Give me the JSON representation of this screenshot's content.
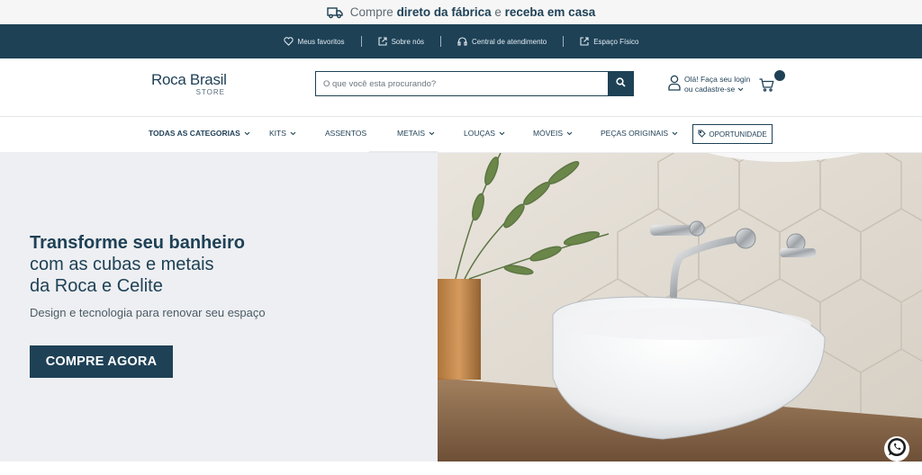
{
  "promo": {
    "prefix": "Compre",
    "bold1": "direto da fábrica",
    "mid": "e",
    "bold2": "receba em casa",
    "icon": "truck-icon"
  },
  "utility": {
    "items": [
      {
        "label": "Meus favoritos",
        "icon": "heart-icon"
      },
      {
        "label": "Sobre nós",
        "icon": "external-link-icon"
      },
      {
        "label": "Central de atendimento",
        "icon": "headset-icon"
      },
      {
        "label": "Espaço Físico",
        "icon": "external-link-icon"
      }
    ]
  },
  "header": {
    "logo_main": "Roca Brasil",
    "logo_sub": "STORE",
    "search_placeholder": "O que você esta procurando?",
    "account_line1": "Olá! Faça seu login",
    "account_line2": "ou cadastre-se"
  },
  "nav": {
    "items": [
      {
        "label": "TODAS AS CATEGORIAS",
        "dropdown": true
      },
      {
        "label": "KITS",
        "dropdown": true
      },
      {
        "label": "ASSENTOS",
        "dropdown": false
      },
      {
        "label": "METAIS",
        "dropdown": true
      },
      {
        "label": "LOUÇAS",
        "dropdown": true
      },
      {
        "label": "MÓVEIS",
        "dropdown": true
      },
      {
        "label": "PEÇAS ORIGINAIS",
        "dropdown": true
      }
    ],
    "oportunidade": "OPORTUNIDADE"
  },
  "hero": {
    "title_bold": "Transforme seu banheiro",
    "title_line2": "com as cubas e metais",
    "title_line3": "da Roca e Celite",
    "subtitle": "Design e tecnologia para renovar seu espaço",
    "cta": "COMPRE AGORA"
  },
  "colors": {
    "primary": "#1e4156",
    "promo_bg": "#f6f6f6",
    "hero_bg": "#eeeff2"
  }
}
